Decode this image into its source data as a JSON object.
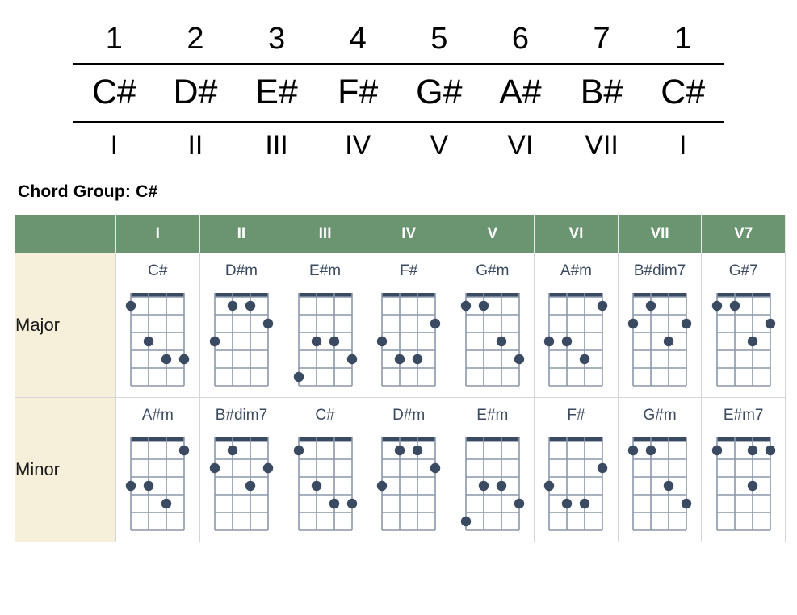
{
  "scale_header": {
    "degrees": [
      "1",
      "2",
      "3",
      "4",
      "5",
      "6",
      "7",
      "1"
    ],
    "notes": [
      "C#",
      "D#",
      "E#",
      "F#",
      "G#",
      "A#",
      "B#",
      "C#"
    ],
    "romans": [
      "I",
      "II",
      "III",
      "IV",
      "V",
      "VI",
      "VII",
      "I"
    ]
  },
  "chord_group": {
    "title": "Chord Group: C#",
    "key": "C#"
  },
  "colors": {
    "header_green": "#6B9570",
    "row_label_cream": "#F6EFDA",
    "diagram_dark": "#3A4A61",
    "diagram_line": "#8A97AC",
    "header_text": "#FFFFFF"
  },
  "table": {
    "columns": [
      "",
      "I",
      "II",
      "III",
      "IV",
      "V",
      "VI",
      "VII",
      "V7"
    ],
    "rows": [
      {
        "label": "Major",
        "chords": [
          {
            "name": "C#",
            "dots": [
              [
                1,
                1
              ],
              [
                2,
                3
              ],
              [
                3,
                4
              ],
              [
                4,
                4
              ]
            ]
          },
          {
            "name": "D#m",
            "dots": [
              [
                2,
                1
              ],
              [
                3,
                1
              ],
              [
                4,
                2
              ],
              [
                1,
                3
              ]
            ]
          },
          {
            "name": "E#m",
            "dots": [
              [
                2,
                3
              ],
              [
                3,
                3
              ],
              [
                4,
                4
              ],
              [
                1,
                5
              ]
            ]
          },
          {
            "name": "F#",
            "dots": [
              [
                4,
                2
              ],
              [
                1,
                3
              ],
              [
                2,
                4
              ],
              [
                3,
                4
              ]
            ]
          },
          {
            "name": "G#m",
            "dots": [
              [
                1,
                1
              ],
              [
                2,
                1
              ],
              [
                3,
                3
              ],
              [
                4,
                4
              ]
            ]
          },
          {
            "name": "A#m",
            "dots": [
              [
                4,
                1
              ],
              [
                1,
                3
              ],
              [
                2,
                3
              ],
              [
                3,
                4
              ]
            ]
          },
          {
            "name": "B#dim7",
            "dots": [
              [
                2,
                1
              ],
              [
                1,
                2
              ],
              [
                4,
                2
              ],
              [
                3,
                3
              ]
            ]
          },
          {
            "name": "G#7",
            "dots": [
              [
                1,
                1
              ],
              [
                2,
                1
              ],
              [
                4,
                2
              ],
              [
                3,
                3
              ]
            ]
          }
        ]
      },
      {
        "label": "Minor",
        "chords": [
          {
            "name": "A#m",
            "dots": [
              [
                4,
                1
              ],
              [
                1,
                3
              ],
              [
                2,
                3
              ],
              [
                3,
                4
              ]
            ]
          },
          {
            "name": "B#dim7",
            "dots": [
              [
                2,
                1
              ],
              [
                1,
                2
              ],
              [
                4,
                2
              ],
              [
                3,
                3
              ]
            ]
          },
          {
            "name": "C#",
            "dots": [
              [
                1,
                1
              ],
              [
                2,
                3
              ],
              [
                3,
                4
              ],
              [
                4,
                4
              ]
            ]
          },
          {
            "name": "D#m",
            "dots": [
              [
                2,
                1
              ],
              [
                3,
                1
              ],
              [
                4,
                2
              ],
              [
                1,
                3
              ]
            ]
          },
          {
            "name": "E#m",
            "dots": [
              [
                2,
                3
              ],
              [
                3,
                3
              ],
              [
                4,
                4
              ],
              [
                1,
                5
              ]
            ]
          },
          {
            "name": "F#",
            "dots": [
              [
                4,
                2
              ],
              [
                1,
                3
              ],
              [
                2,
                4
              ],
              [
                3,
                4
              ]
            ]
          },
          {
            "name": "G#m",
            "dots": [
              [
                1,
                1
              ],
              [
                2,
                1
              ],
              [
                3,
                3
              ],
              [
                4,
                4
              ]
            ]
          },
          {
            "name": "E#m7",
            "dots": [
              [
                1,
                1
              ],
              [
                3,
                1
              ],
              [
                4,
                1
              ],
              [
                3,
                3
              ]
            ]
          }
        ]
      }
    ]
  },
  "diagram_spec": {
    "strings": 4,
    "frets": 5,
    "instrument": "ukulele"
  }
}
